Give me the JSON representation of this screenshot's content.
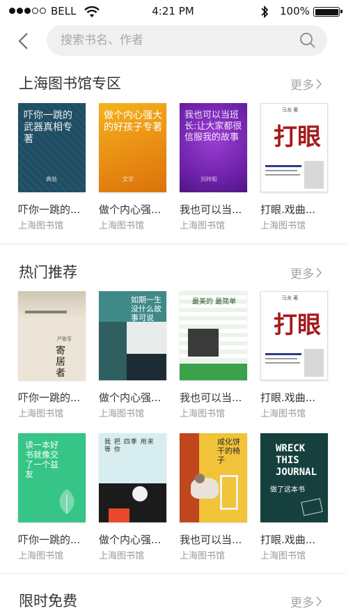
{
  "status_bar": {
    "carrier": "BELL",
    "time": "4:21 PM",
    "battery": "100%"
  },
  "search": {
    "placeholder": "搜索书名、作者"
  },
  "sections": [
    {
      "title": "上海图书馆专区",
      "more": "更多",
      "books": [
        {
          "title": "吓你一跳的...",
          "source": "上海图书馆",
          "cover_text": "吓你一跳的武器真相专著",
          "cover_author": "典勋"
        },
        {
          "title": "做个内心强...",
          "source": "上海图书馆",
          "cover_text": "做个内心强大的好孩子专著",
          "cover_author": "文学"
        },
        {
          "title": "我也可以当...",
          "source": "上海图书馆",
          "cover_text": "我也可以当班长:让大家都很信服我的故事",
          "cover_author": "刘祥和"
        },
        {
          "title": "打眼.戏曲...",
          "source": "上海图书馆",
          "cover_text": "打眼",
          "cover_author": "马龙 著"
        }
      ]
    },
    {
      "title": "热门推荐",
      "more": "更多",
      "books": [
        {
          "title": "吓你一跳的...",
          "source": "上海图书馆",
          "cover_text": "寄居者",
          "cover_author": "严歌苓"
        },
        {
          "title": "做个内心强...",
          "source": "上海图书馆",
          "cover_text": "如期一生没什么故事可说",
          "cover_author": ""
        },
        {
          "title": "我也可以当...",
          "source": "上海图书馆",
          "cover_text": "最美的 最简单",
          "cover_author": ""
        },
        {
          "title": "打眼.戏曲...",
          "source": "上海图书馆",
          "cover_text": "打眼",
          "cover_author": "马龙 著"
        }
      ]
    },
    {
      "books": [
        {
          "title": "吓你一跳的...",
          "source": "上海图书馆",
          "cover_text": "读一本好书就像交了一个益友",
          "cover_author": ""
        },
        {
          "title": "做个内心强...",
          "source": "上海图书馆",
          "cover_text": "我 把 四季 用来 等 你",
          "cover_author": ""
        },
        {
          "title": "我也可以当...",
          "source": "上海图书馆",
          "cover_text": "咸化饼干的椅子",
          "cover_author": ""
        },
        {
          "title": "打眼.戏曲...",
          "source": "上海图书馆",
          "cover_text": "WRECK THIS JOURNAL",
          "cover_author": "做了这本书"
        }
      ]
    },
    {
      "title": "限时免费",
      "more": "更多"
    }
  ]
}
